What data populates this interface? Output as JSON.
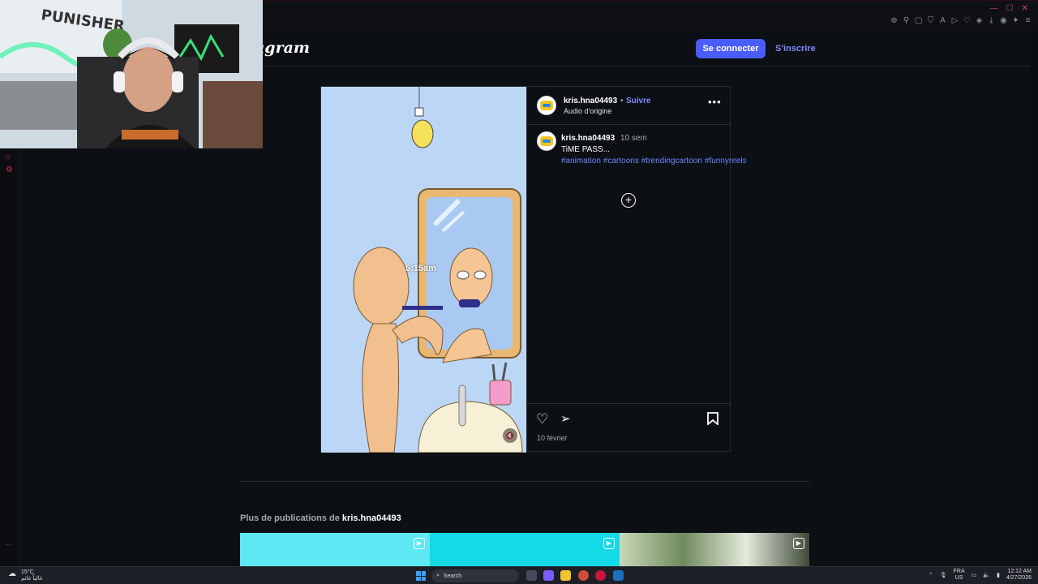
{
  "header": {
    "logo_text": "agram",
    "login_label": "Se connecter",
    "signup_label": "S'inscrire"
  },
  "post": {
    "username": "kris.hna04493",
    "dot": "•",
    "follow_label": "Suivre",
    "audio_label": "Audio d'origine",
    "more_icon": "more-horizontal-icon",
    "caption_username": "kris.hna04493",
    "caption_time": "10 sem",
    "caption_text": "TiME PASS...",
    "hashtags": [
      "#animation",
      "#cartoons",
      "#trendingcartoon",
      "#funnyreels"
    ],
    "date": "10 février",
    "video_overlay_text": "5:15am",
    "icons": {
      "like": "heart-icon",
      "share": "send-icon",
      "save": "bookmark-icon",
      "add": "plus-circle-icon",
      "mute": "speaker-muted-icon"
    }
  },
  "more_posts": {
    "prefix": "Plus de publications de",
    "username": "kris.hna04493",
    "thumbnail_colors": [
      "#5ee8f4",
      "#14d9e6",
      "#9fb88c"
    ]
  },
  "taskbar": {
    "weather_temp": "15°C",
    "weather_text": "غالباً غائم",
    "search_label": "Search",
    "lang_top": "FRA",
    "lang_bottom": "US",
    "time": "12:12 AM",
    "date": "4/27/2026"
  },
  "colors": {
    "accent": "#4a5df9",
    "link": "#7f8bff",
    "hashtag": "#6f86ff",
    "page_bg": "#0c0f14"
  }
}
